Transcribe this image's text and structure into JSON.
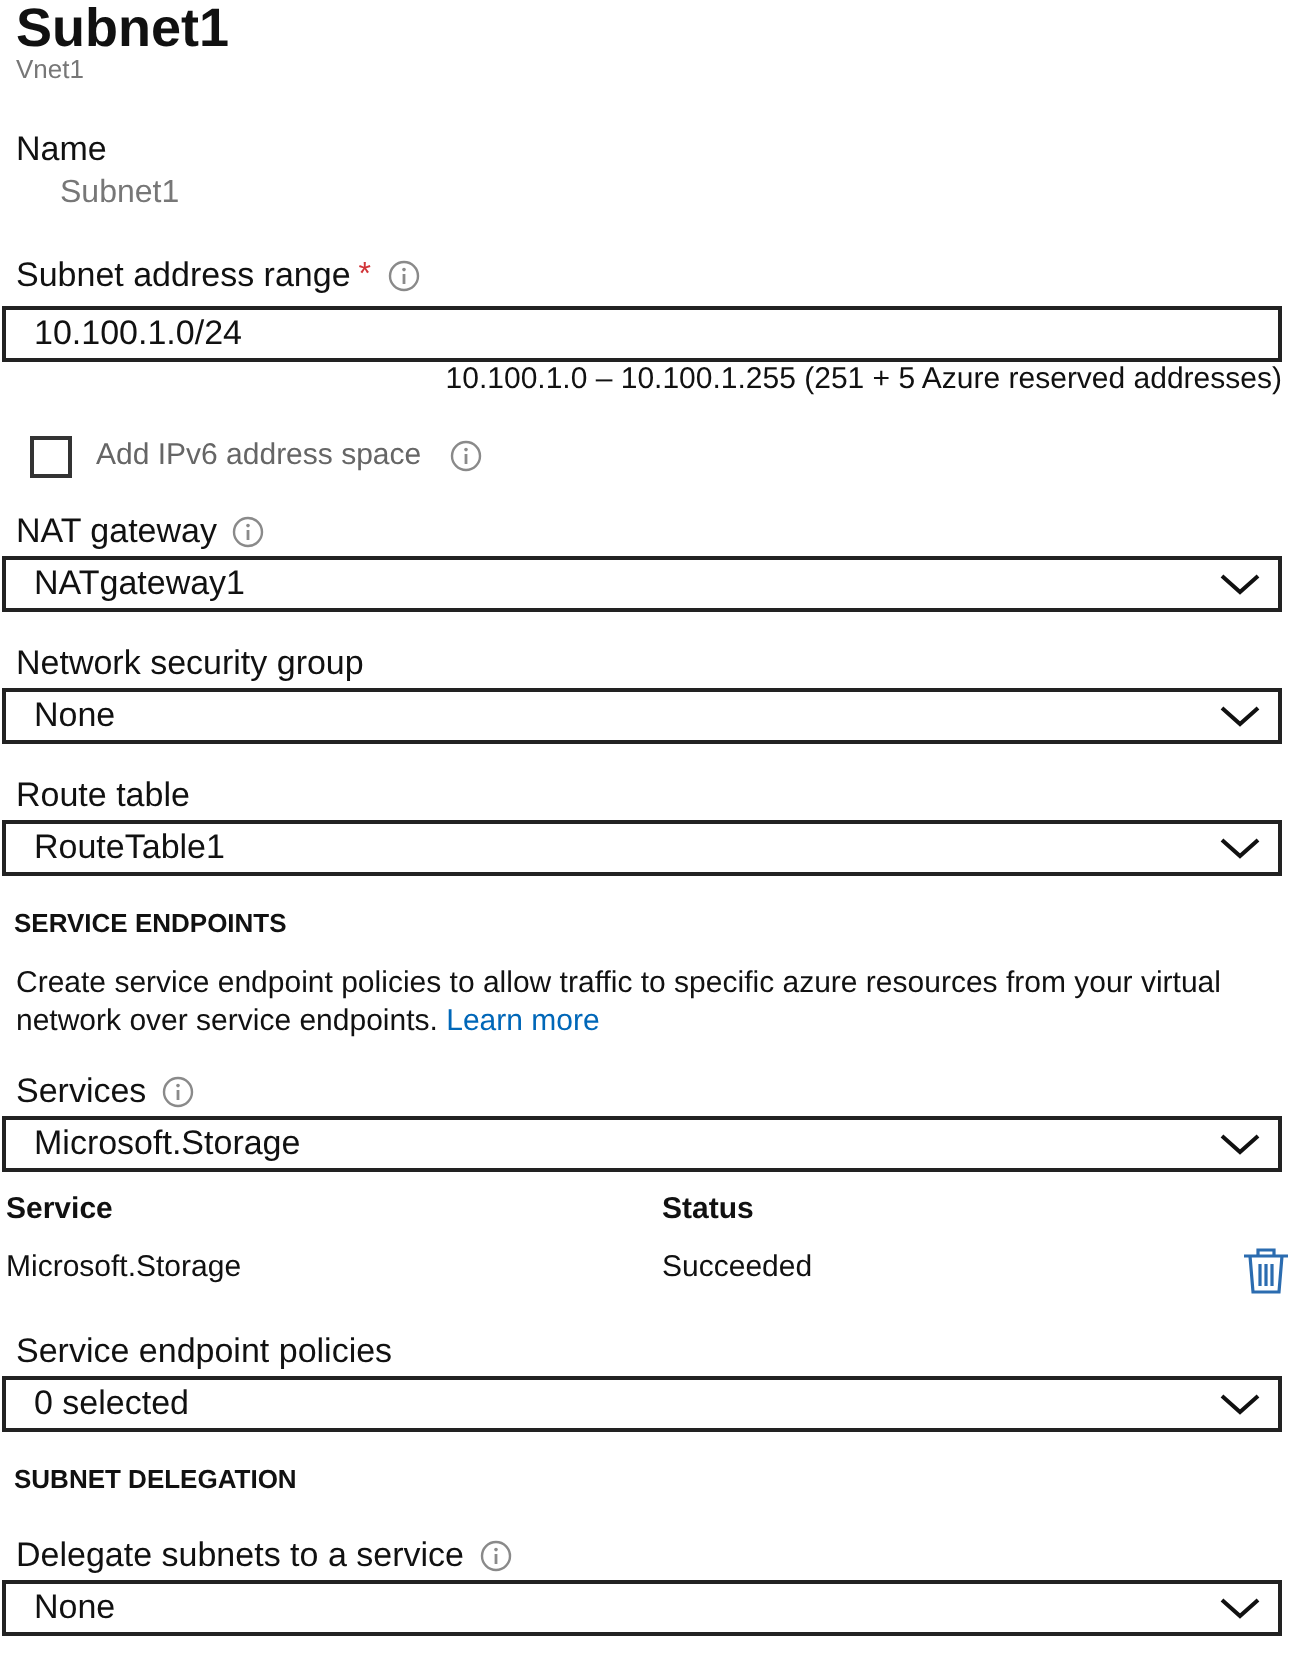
{
  "title": "Subnet1",
  "subtitle": "Vnet1",
  "items": [
    {
      "kind": "readonly",
      "label": "Name",
      "value": "Subnet1"
    },
    {
      "kind": "input",
      "label": "Subnet address range",
      "required": "*",
      "info": true,
      "value": "10.100.1.0/24",
      "hint": "10.100.1.0 – 10.100.1.255 (251 + 5 Azure reserved addresses)"
    },
    {
      "kind": "checkbox",
      "label": "Add IPv6 address space",
      "checked": false,
      "info": true
    },
    {
      "kind": "dropdown",
      "label": "NAT gateway",
      "info": true,
      "value": "NATgateway1"
    },
    {
      "kind": "dropdown",
      "label": "Network security group",
      "info": false,
      "value": "None"
    },
    {
      "kind": "dropdown",
      "label": "Route table",
      "info": false,
      "value": "RouteTable1"
    },
    {
      "kind": "heading",
      "text": "SERVICE ENDPOINTS"
    },
    {
      "kind": "paragraph",
      "text": "Create service endpoint policies to allow traffic to specific azure resources from your virtual network over service endpoints.",
      "link": "Learn more"
    },
    {
      "kind": "dropdown",
      "label": "Services",
      "info": true,
      "value": "Microsoft.Storage"
    },
    {
      "kind": "table",
      "columns": [
        "Service",
        "Status"
      ],
      "rows": [
        {
          "service": "Microsoft.Storage",
          "status": "Succeeded"
        }
      ]
    },
    {
      "kind": "dropdown",
      "label": "Service endpoint policies",
      "info": false,
      "value": "0 selected"
    },
    {
      "kind": "heading",
      "text": "SUBNET DELEGATION"
    },
    {
      "kind": "dropdown",
      "label": "Delegate subnets to a service",
      "info": true,
      "value": "None"
    }
  ]
}
